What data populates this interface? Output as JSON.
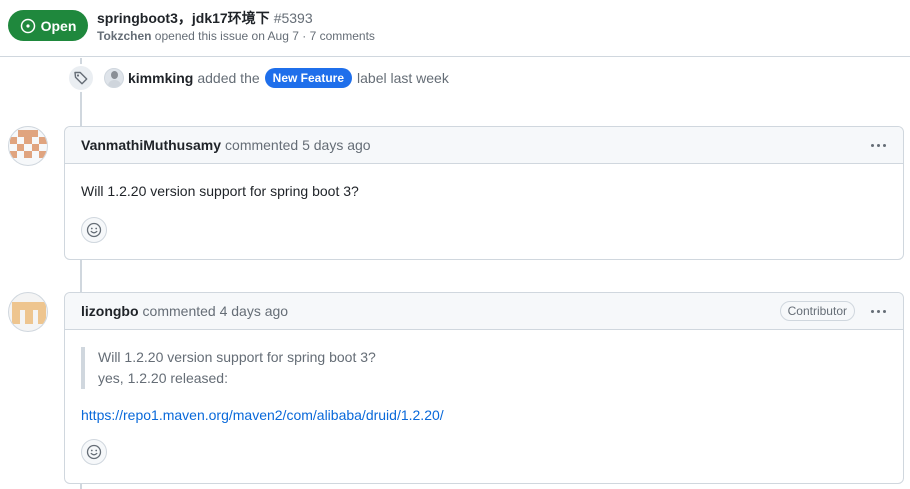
{
  "header": {
    "state_label": "Open",
    "title": "springboot3，jdk17环境下",
    "number": "#5393",
    "author": "Tokzchen",
    "meta_text": "opened this issue on Aug 7 · 7 comments"
  },
  "label_event": {
    "actor": "kimmking",
    "action": "added the",
    "label": "New Feature",
    "label_color": "#1f6feb",
    "suffix": "label last week",
    "icon": "tag-icon"
  },
  "comments": [
    {
      "author": "VanmathiMuthusamy",
      "when": "commented 5 days ago",
      "body": "Will 1.2.20 version support for spring boot 3?",
      "avatar_color": "#e0a47f"
    },
    {
      "author": "lizongbo",
      "when": "commented 4 days ago",
      "role": "Contributor",
      "quote_lines": [
        "Will 1.2.20 version support for spring boot 3?",
        "yes, 1.2.20 released:"
      ],
      "link": "https://repo1.maven.org/maven2/com/alibaba/druid/1.2.20/",
      "avatar_color": "#eec58f"
    }
  ],
  "colors": {
    "open_green": "#1f883d",
    "link_blue": "#0969da",
    "border": "#d0d7de"
  }
}
